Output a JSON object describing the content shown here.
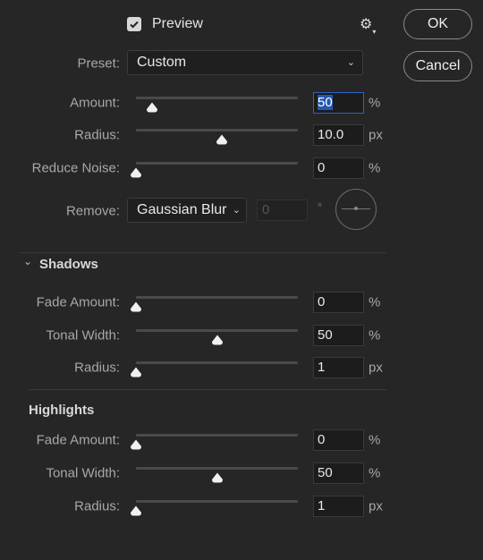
{
  "header": {
    "preview_label": "Preview",
    "preview_checked": true,
    "ok_label": "OK",
    "cancel_label": "Cancel",
    "settings_icon": "gear-icon"
  },
  "preset": {
    "label": "Preset:",
    "value": "Custom"
  },
  "sharpen": [
    {
      "label": "Amount:",
      "value": "50",
      "unit": "%",
      "slider_position": 0.1
    },
    {
      "label": "Radius:",
      "value": "10.0",
      "unit": "px",
      "slider_position": 0.53
    },
    {
      "label": "Reduce Noise:",
      "value": "0",
      "unit": "%",
      "slider_position": 0
    }
  ],
  "remove": {
    "label": "Remove:",
    "value": "Gaussian Blur",
    "angle": "0",
    "angle_unit": "°"
  },
  "shadows": {
    "title": "Shadows",
    "rows": [
      {
        "label": "Fade Amount:",
        "value": "0",
        "unit": "%",
        "slider_position": 0
      },
      {
        "label": "Tonal Width:",
        "value": "50",
        "unit": "%",
        "slider_position": 0.5
      },
      {
        "label": "Radius:",
        "value": "1",
        "unit": "px",
        "slider_position": 0
      }
    ]
  },
  "highlights": {
    "title": "Highlights",
    "rows": [
      {
        "label": "Fade Amount:",
        "value": "0",
        "unit": "%",
        "slider_position": 0
      },
      {
        "label": "Tonal Width:",
        "value": "50",
        "unit": "%",
        "slider_position": 0.5
      },
      {
        "label": "Radius:",
        "value": "1",
        "unit": "px",
        "slider_position": 0
      }
    ]
  },
  "colors": {
    "background": "#262626",
    "focus": "#2a63c9"
  }
}
